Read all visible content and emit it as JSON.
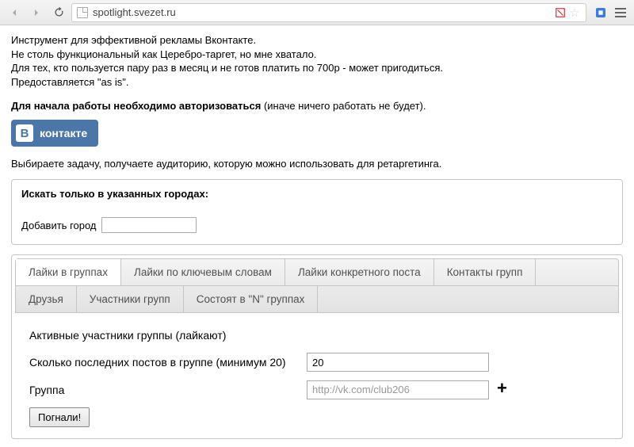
{
  "browser": {
    "url": "spotlight.svezet.ru"
  },
  "intro": {
    "line1": "Инструмент для эффективной рекламы Вконтакте.",
    "line2": "Не столь функциональный как Церебро-таргет, но мне хватало.",
    "line3": "Для тех, кто пользуется пару раз в месяц и не готов платить по 700р - может пригодиться.",
    "line4": "Предоставляется \"as is\"."
  },
  "auth": {
    "bold": "Для начала работы необходимо авторизоваться",
    "rest": " (иначе ничего работать не будет)."
  },
  "vk": {
    "label": "контакте",
    "letter": "В"
  },
  "subhead": "Выбираете задачу, получаете аудиторию, которую можно использовать для ретаргетинга.",
  "cityBox": {
    "heading": "Искать только в указанных городах:",
    "addLabel": "Добавить город",
    "value": ""
  },
  "tabs": {
    "row1": [
      {
        "label": "Лайки в группах",
        "active": true
      },
      {
        "label": "Лайки по ключевым словам",
        "active": false
      },
      {
        "label": "Лайки конкретного поста",
        "active": false
      },
      {
        "label": "Контакты групп",
        "active": false
      }
    ],
    "row2": [
      {
        "label": "Друзья"
      },
      {
        "label": "Участники групп"
      },
      {
        "label": "Состоят в \"N\" группах"
      }
    ]
  },
  "panel": {
    "heading": "Активные участники группы (лайкают)",
    "postsLabel": "Сколько последних постов в группе (минимум 20)",
    "postsValue": "20",
    "groupLabel": "Группа",
    "groupPlaceholder": "http://vk.com/club206",
    "goLabel": "Погнали!"
  }
}
